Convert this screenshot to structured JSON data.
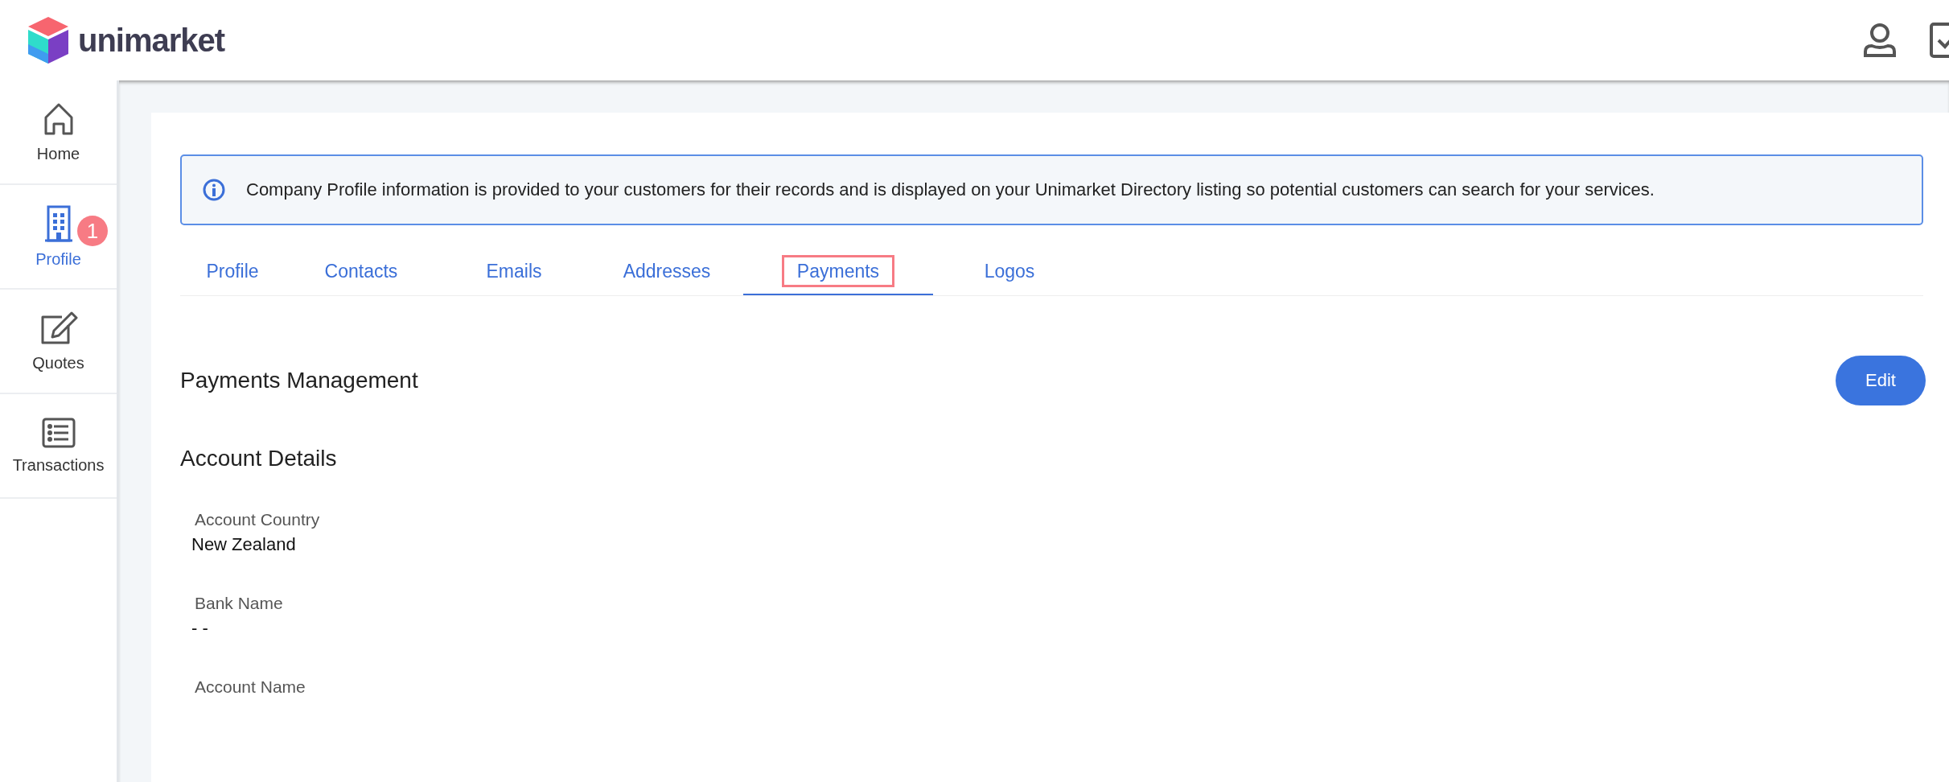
{
  "header": {
    "brand": "unimarket"
  },
  "sidebar": {
    "items": [
      {
        "kind": "home",
        "label": "Home",
        "selected": false
      },
      {
        "kind": "profile",
        "label": "Profile",
        "selected": true,
        "badge": "1"
      },
      {
        "kind": "quotes",
        "label": "Quotes",
        "selected": false
      },
      {
        "kind": "transactions",
        "label": "Transactions",
        "selected": false
      }
    ]
  },
  "info_banner": {
    "text": "Company Profile information is provided to your customers for their records and is displayed on your Unimarket Directory listing so potential customers can search for your services."
  },
  "tabs": [
    {
      "label": "Profile",
      "selected": false,
      "highlighted": false
    },
    {
      "label": "Contacts",
      "selected": false,
      "highlighted": false
    },
    {
      "label": "Emails",
      "selected": false,
      "highlighted": false
    },
    {
      "label": "Addresses",
      "selected": false,
      "highlighted": false
    },
    {
      "label": "Payments",
      "selected": true,
      "highlighted": true
    },
    {
      "label": "Logos",
      "selected": false,
      "highlighted": false
    }
  ],
  "section": {
    "title": "Payments Management",
    "edit_button": "Edit"
  },
  "subsection": {
    "title": "Account Details"
  },
  "fields": [
    {
      "label": "Account Country",
      "value": "New Zealand"
    },
    {
      "label": "Bank Name",
      "value": "- -"
    },
    {
      "label": "Account Name"
    }
  ]
}
